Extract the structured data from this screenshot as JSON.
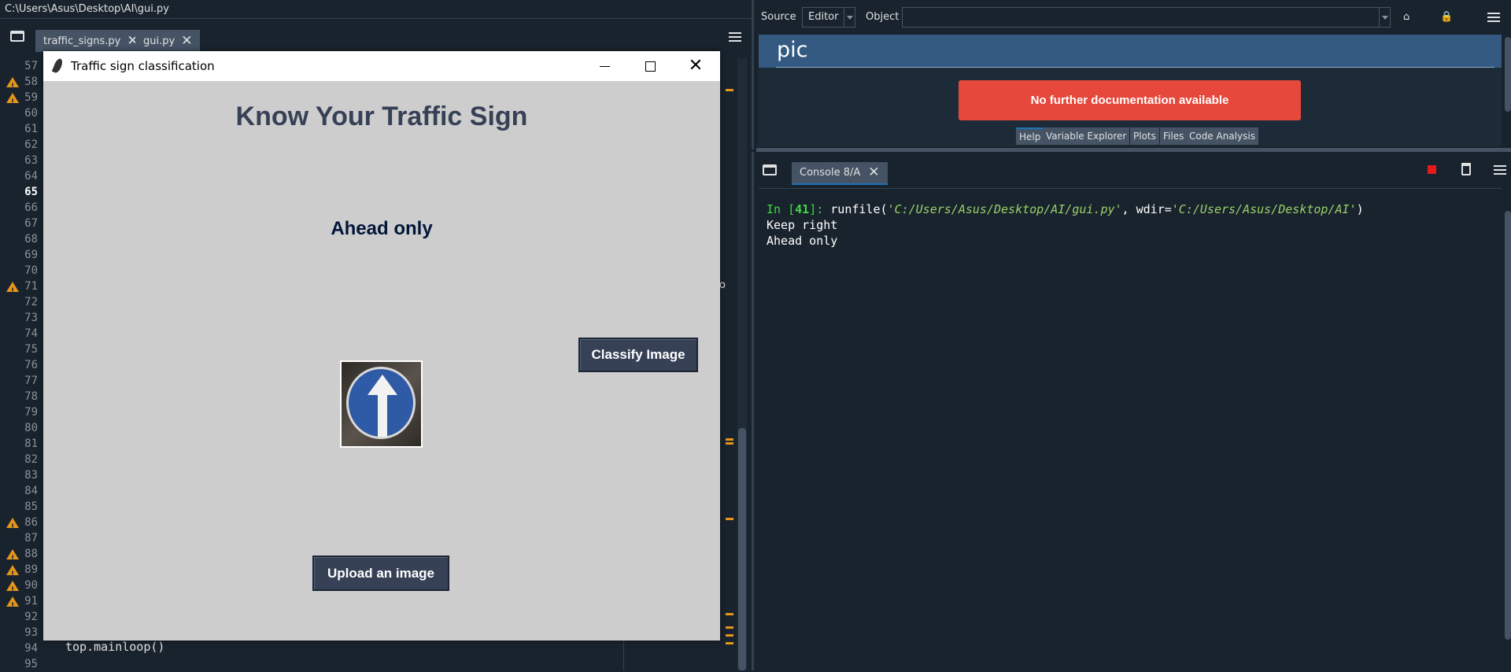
{
  "editor": {
    "file_path": "C:\\Users\\Asus\\Desktop\\AI\\gui.py",
    "tabs": [
      {
        "label": "traffic_signs.py"
      },
      {
        "label": "gui.py"
      }
    ],
    "line_numbers": [
      "57",
      "58",
      "59",
      "60",
      "61",
      "62",
      "63",
      "64",
      "65",
      "66",
      "67",
      "68",
      "69",
      "70",
      "71",
      "72",
      "73",
      "74",
      "75",
      "76",
      "77",
      "78",
      "79",
      "80",
      "81",
      "82",
      "83",
      "84",
      "85",
      "86",
      "87",
      "88",
      "89",
      "90",
      "91",
      "92",
      "93",
      "94",
      "95"
    ],
    "current_line": "65",
    "warning_lines": [
      "58",
      "59",
      "71",
      "86",
      "88",
      "89",
      "90",
      "91"
    ],
    "visible_code": "top.mainloop()",
    "clipped_glyph": "o"
  },
  "tk_window": {
    "title": "Traffic sign classification",
    "heading": "Know Your Traffic Sign",
    "result_label": "Ahead only",
    "classify_button": "Classify Image",
    "upload_button": "Upload an image",
    "heading_color": "#364156",
    "result_color": "#011638",
    "button_color": "#364156",
    "background": "#cdcdcd"
  },
  "help": {
    "source_label": "Source",
    "source_value": "Editor",
    "object_label": "Object",
    "object_value": "",
    "object_name": "pic",
    "no_doc_message": "No further documentation available",
    "tabs": [
      "Help",
      "Variable Explorer",
      "Plots",
      "Files",
      "Code Analysis"
    ],
    "active_tab": "Help",
    "banner_color": "#e6483b"
  },
  "console": {
    "tab_label": "Console 8/A",
    "prompt_in": "In [",
    "prompt_num": "41",
    "prompt_close": "]:",
    "cmd_head": " runfile(",
    "cmd_arg1": "'C:/Users/Asus/Desktop/AI/gui.py'",
    "cmd_mid": ", wdir=",
    "cmd_arg2": "'C:/Users/Asus/Desktop/AI'",
    "cmd_tail": ")",
    "output": [
      "Keep right",
      "Ahead only"
    ]
  }
}
